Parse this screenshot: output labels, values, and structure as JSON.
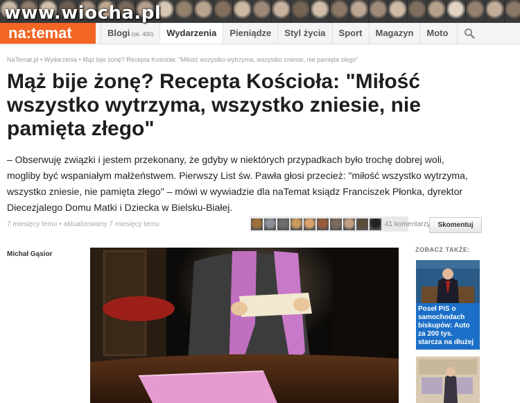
{
  "watermark": "www.wiocha.pl",
  "portrait_colors": [
    "#c9b7a4",
    "#8e7b6a",
    "#d3c2ae",
    "#6e5d4f",
    "#a89482",
    "#c1a891",
    "#7a6a5c",
    "#b39f8c",
    "#d8c7b4",
    "#957f6d",
    "#b9a38f",
    "#836f5e",
    "#cbb8a3",
    "#9d8875",
    "#c6b19c",
    "#746453",
    "#d1bda9",
    "#8b7765",
    "#bea893",
    "#a08b78",
    "#cfbca7",
    "#7e6e5e",
    "#b5a08b",
    "#e2d3c2",
    "#93806e",
    "#c4ae99",
    "#8a7766"
  ],
  "logo": "na:temat",
  "nav": {
    "items": [
      {
        "label": "Blogi",
        "sup": "(ok. 400)"
      },
      {
        "label": "Wydarzenia",
        "sup": ""
      },
      {
        "label": "Pieniądze",
        "sup": ""
      },
      {
        "label": "Styl życia",
        "sup": ""
      },
      {
        "label": "Sport",
        "sup": ""
      },
      {
        "label": "Magazyn",
        "sup": ""
      },
      {
        "label": "Moto",
        "sup": ""
      }
    ],
    "search_icon": "search-icon"
  },
  "breadcrumb": "NaTemat.pl • Wydarzenia • Mąż bije żonę? Recepta Kościoła: \"Miłość wszystko wytrzyma, wszystko zniesie, nie pamięta złego\"",
  "article": {
    "title": "Mąż bije żonę? Recepta Kościoła: \"Miłość wszystko wytrzyma, wszystko zniesie, nie pamięta złego\"",
    "lead": "– Obserwuję związki i jestem przekonany, że gdyby w niektórych przypadkach było trochę dobrej woli, mogliby być wspaniałym małżeństwem. Pierwszy List św. Pawła głosi przecież: \"miłość wszystko wytrzyma, wszystko zniesie, nie pamięta złego\" – mówi w wywiadzie dla naTemat ksiądz Franciszek Płonka, dyrektor Diecezjalego Domu Matki i Dziecka w Bielsku-Białej.",
    "published": "7 miesięcy temu",
    "updated": "aktualizowany 7 miesięcy temu",
    "comments_count": "41 komentarzy",
    "comment_button": "Skomentuj",
    "author": "Michał Gąsior"
  },
  "commenter_colors": [
    "#a0703c",
    "#8a8f9a",
    "#6d6d6d",
    "#c89a5c",
    "#d7a36a",
    "#9a5b3c",
    "#7a6a5a",
    "#c0a080",
    "#5c4c3c",
    "#222222"
  ],
  "sidebar": {
    "heading": "ZOBACZ TAKŻE:",
    "card_caption": "Poseł PiS o samochodach biskupów: Auto za 200 tys. starcza na dłużej"
  }
}
